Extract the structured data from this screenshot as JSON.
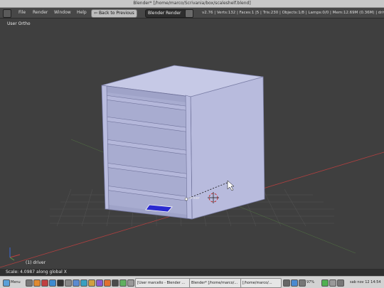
{
  "window": {
    "title": "Blender* [/home/marco/Scrivania/box/scaleshelf.blend]"
  },
  "infobar": {
    "menus": [
      "File",
      "Render",
      "Window",
      "Help"
    ],
    "back_button": "Back to Previous",
    "render_engine": "Blender Render",
    "stats": "v2.76 | Verts:132 | Faces:1 |5 | Tris:230 | Objects:1/8 | Lamps:0/0 | Mem:12.69M (0.36M) | driver"
  },
  "viewport": {
    "view_name": "User Ortho",
    "object_label": "(1) driver",
    "driver_label": "driver"
  },
  "statusbar": {
    "text": "Scale: 4.0987 along global X"
  },
  "taskbar": {
    "menu_label": "Menu",
    "tasks": [
      "[User marcello - Blender ...",
      "Blender* [/home/marco/...",
      "[/home/marco/..."
    ],
    "battery": "97%",
    "clock": "sab nov 12 14:54"
  },
  "colors": {
    "viewport_bg": "#3f3f3f",
    "shelf_front": "#9fa3c8",
    "shelf_side": "#b6b9dc",
    "x_axis": "#c04040",
    "y_axis": "#6aa04a",
    "driver_plane": "#2a2ad0"
  }
}
